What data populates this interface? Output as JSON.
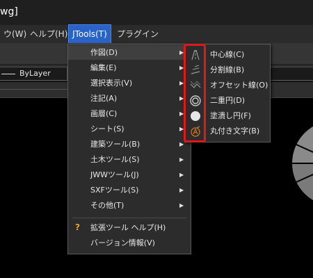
{
  "window": {
    "title": "wg]"
  },
  "menubar": {
    "items": [
      {
        "label": "ウ(W)"
      },
      {
        "label": "ヘルプ(H)"
      },
      {
        "label": "JTools(T)"
      },
      {
        "label": "プラグイン"
      }
    ]
  },
  "properties": {
    "layer": "ByLayer"
  },
  "jtools_menu": {
    "items": [
      {
        "label": "作図(D)"
      },
      {
        "label": "編集(E)"
      },
      {
        "label": "選択表示(V)"
      },
      {
        "label": "注記(A)"
      },
      {
        "label": "画層(C)"
      },
      {
        "label": "シート(S)"
      },
      {
        "label": "建築ツール(B)"
      },
      {
        "label": "土木ツール(S)"
      },
      {
        "label": "JWWツール(J)"
      },
      {
        "label": "SXFツール(S)"
      },
      {
        "label": "その他(T)"
      },
      {
        "label": "拡張ツール ヘルプ(H)",
        "icon": "?"
      },
      {
        "label": "バージョン情報(V)"
      }
    ]
  },
  "draw_submenu": {
    "items": [
      {
        "label": "中心線(C)",
        "icon": "centerline-icon"
      },
      {
        "label": "分割線(B)",
        "icon": "divide-line-icon"
      },
      {
        "label": "オフセット線(O)",
        "icon": "offset-line-icon"
      },
      {
        "label": "二重円(D)",
        "icon": "double-circle-icon"
      },
      {
        "label": "塗潰し円(F)",
        "icon": "filled-circle-icon"
      },
      {
        "label": "丸付き文字(B)",
        "icon": "circled-letter-icon"
      }
    ]
  },
  "colors": {
    "menu_active": "#2a63c7",
    "highlight_border": "#e01818",
    "help_icon": "#f0a030"
  }
}
